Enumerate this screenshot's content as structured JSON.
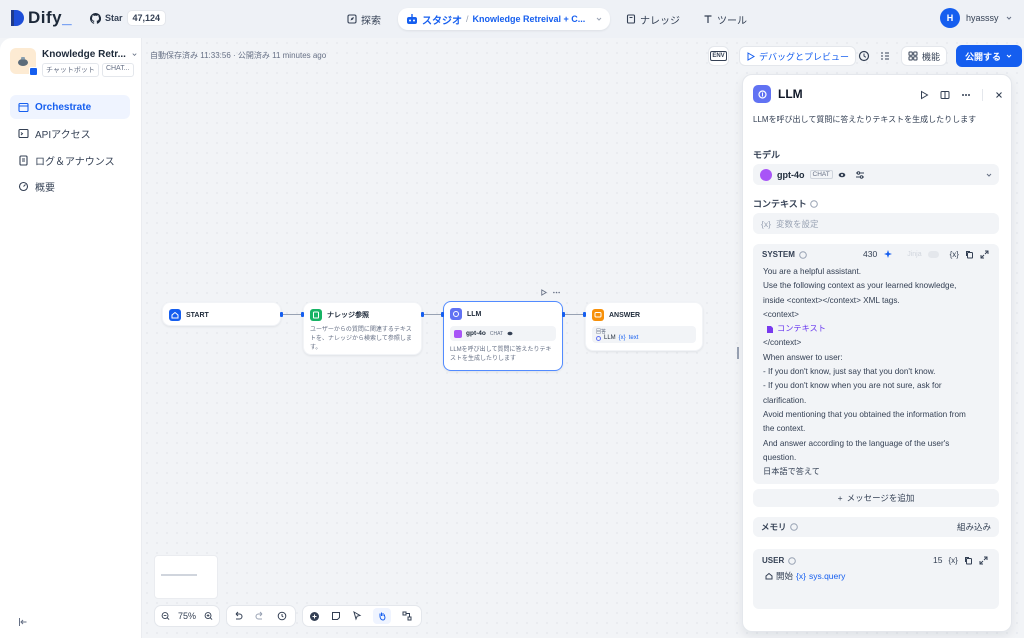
{
  "topbar": {
    "logo_text": "Dify",
    "github_label": "Star",
    "github_count": "47,124",
    "nav_explore": "探索",
    "nav_studio": "スタジオ",
    "app_name": "Knowledge Retreival + C...",
    "nav_knowledge": "ナレッジ",
    "nav_tools": "ツール",
    "user_initial": "H",
    "user_name": "hyasssy"
  },
  "sidebar": {
    "app_name": "Knowledge Retr...",
    "app_tag_1": "チャットボット",
    "app_tag_2": "CHAT...",
    "items": [
      {
        "label": "Orchestrate",
        "active": true,
        "icon": "orchestrate-icon"
      },
      {
        "label": "APIアクセス",
        "active": false,
        "icon": "terminal-icon"
      },
      {
        "label": "ログ＆アナウンス",
        "active": false,
        "icon": "file-list-icon"
      },
      {
        "label": "概要",
        "active": false,
        "icon": "dashboard-icon"
      }
    ]
  },
  "canvas": {
    "autosave": "自動保存済み 11:33:56 · 公開済み 11 minutes ago",
    "env_label": "ENV",
    "debug_label": "デバッグとプレビュー",
    "features_label": "機能",
    "publish_label": "公開する",
    "nodes": {
      "start": {
        "title": "START"
      },
      "knowledge": {
        "title": "ナレッジ参照",
        "desc": "ユーザーからの質問に関連するテキストを、ナレッジから検索して参照します。"
      },
      "llm": {
        "title": "LLM",
        "model": "gpt-4o",
        "mode": "CHAT",
        "desc": "LLMを呼び出して質問に答えたりテキストを生成したりします"
      },
      "answer": {
        "title": "ANSWER",
        "sub": "回答",
        "var_node": "LLM",
        "var_name": "text"
      }
    },
    "zoom": "75%"
  },
  "panel": {
    "title": "LLM",
    "desc": "LLMを呼び出して質問に答えたりテキストを生成したりします",
    "model_section": "モデル",
    "model_name": "gpt-4o",
    "model_mode": "CHAT",
    "context_section": "コンテキスト",
    "context_placeholder": "変数を設定",
    "system_label": "SYSTEM",
    "system_count": "430",
    "jinja_label": "Jinja",
    "system_lines": [
      "You are a helpful assistant.",
      "Use the following context as your learned knowledge,",
      "inside <context></context> XML tags.",
      "<context>",
      "",
      "</context>",
      "When answer to user:",
      "- If you don't know, just say that you don't know.",
      "- If you don't know when you are not sure, ask for",
      "clarification.",
      "Avoid mentioning that you obtained the information from",
      "the context.",
      "And answer according to the language of the user's",
      "question.",
      "日本語で答えて"
    ],
    "context_var": "コンテキスト",
    "add_message": "メッセージを追加",
    "memory_label": "メモリ",
    "memory_builtin": "組み込み",
    "user_label": "USER",
    "user_count": "15",
    "user_var_node": "開始",
    "user_var_name": "sys.query"
  }
}
